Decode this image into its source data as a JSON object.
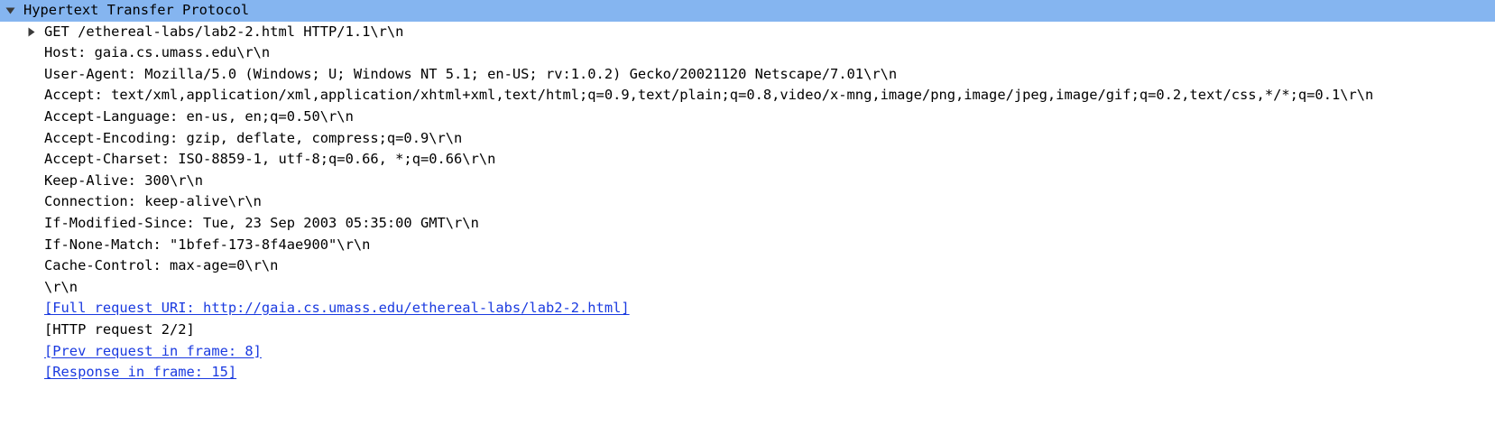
{
  "packet_details": {
    "protocol_header": "Hypertext Transfer Protocol",
    "request_line": "GET /ethereal-labs/lab2-2.html HTTP/1.1\\r\\n",
    "headers": [
      "Host: gaia.cs.umass.edu\\r\\n",
      "User-Agent: Mozilla/5.0 (Windows; U; Windows NT 5.1; en-US; rv:1.0.2) Gecko/20021120 Netscape/7.01\\r\\n",
      "Accept: text/xml,application/xml,application/xhtml+xml,text/html;q=0.9,text/plain;q=0.8,video/x-mng,image/png,image/jpeg,image/gif;q=0.2,text/css,*/*;q=0.1\\r\\n",
      "Accept-Language: en-us, en;q=0.50\\r\\n",
      "Accept-Encoding: gzip, deflate, compress;q=0.9\\r\\n",
      "Accept-Charset: ISO-8859-1, utf-8;q=0.66, *;q=0.66\\r\\n",
      "Keep-Alive: 300\\r\\n",
      "Connection: keep-alive\\r\\n",
      "If-Modified-Since: Tue, 23 Sep 2003 05:35:00 GMT\\r\\n",
      "If-None-Match: \"1bfef-173-8f4ae900\"\\r\\n",
      "Cache-Control: max-age=0\\r\\n",
      "\\r\\n"
    ],
    "full_request_uri": "[Full request URI: http://gaia.cs.umass.edu/ethereal-labs/lab2-2.html]",
    "http_request_count": "[HTTP request 2/2]",
    "prev_request_frame": "[Prev request in frame: 8]",
    "response_frame": "[Response in frame: 15]"
  },
  "colors": {
    "selection": "#85b5f0",
    "link": "#1a3ae0",
    "text": "#000000"
  },
  "icons": {
    "expanded": "triangle-down-icon",
    "collapsed": "triangle-right-icon"
  }
}
